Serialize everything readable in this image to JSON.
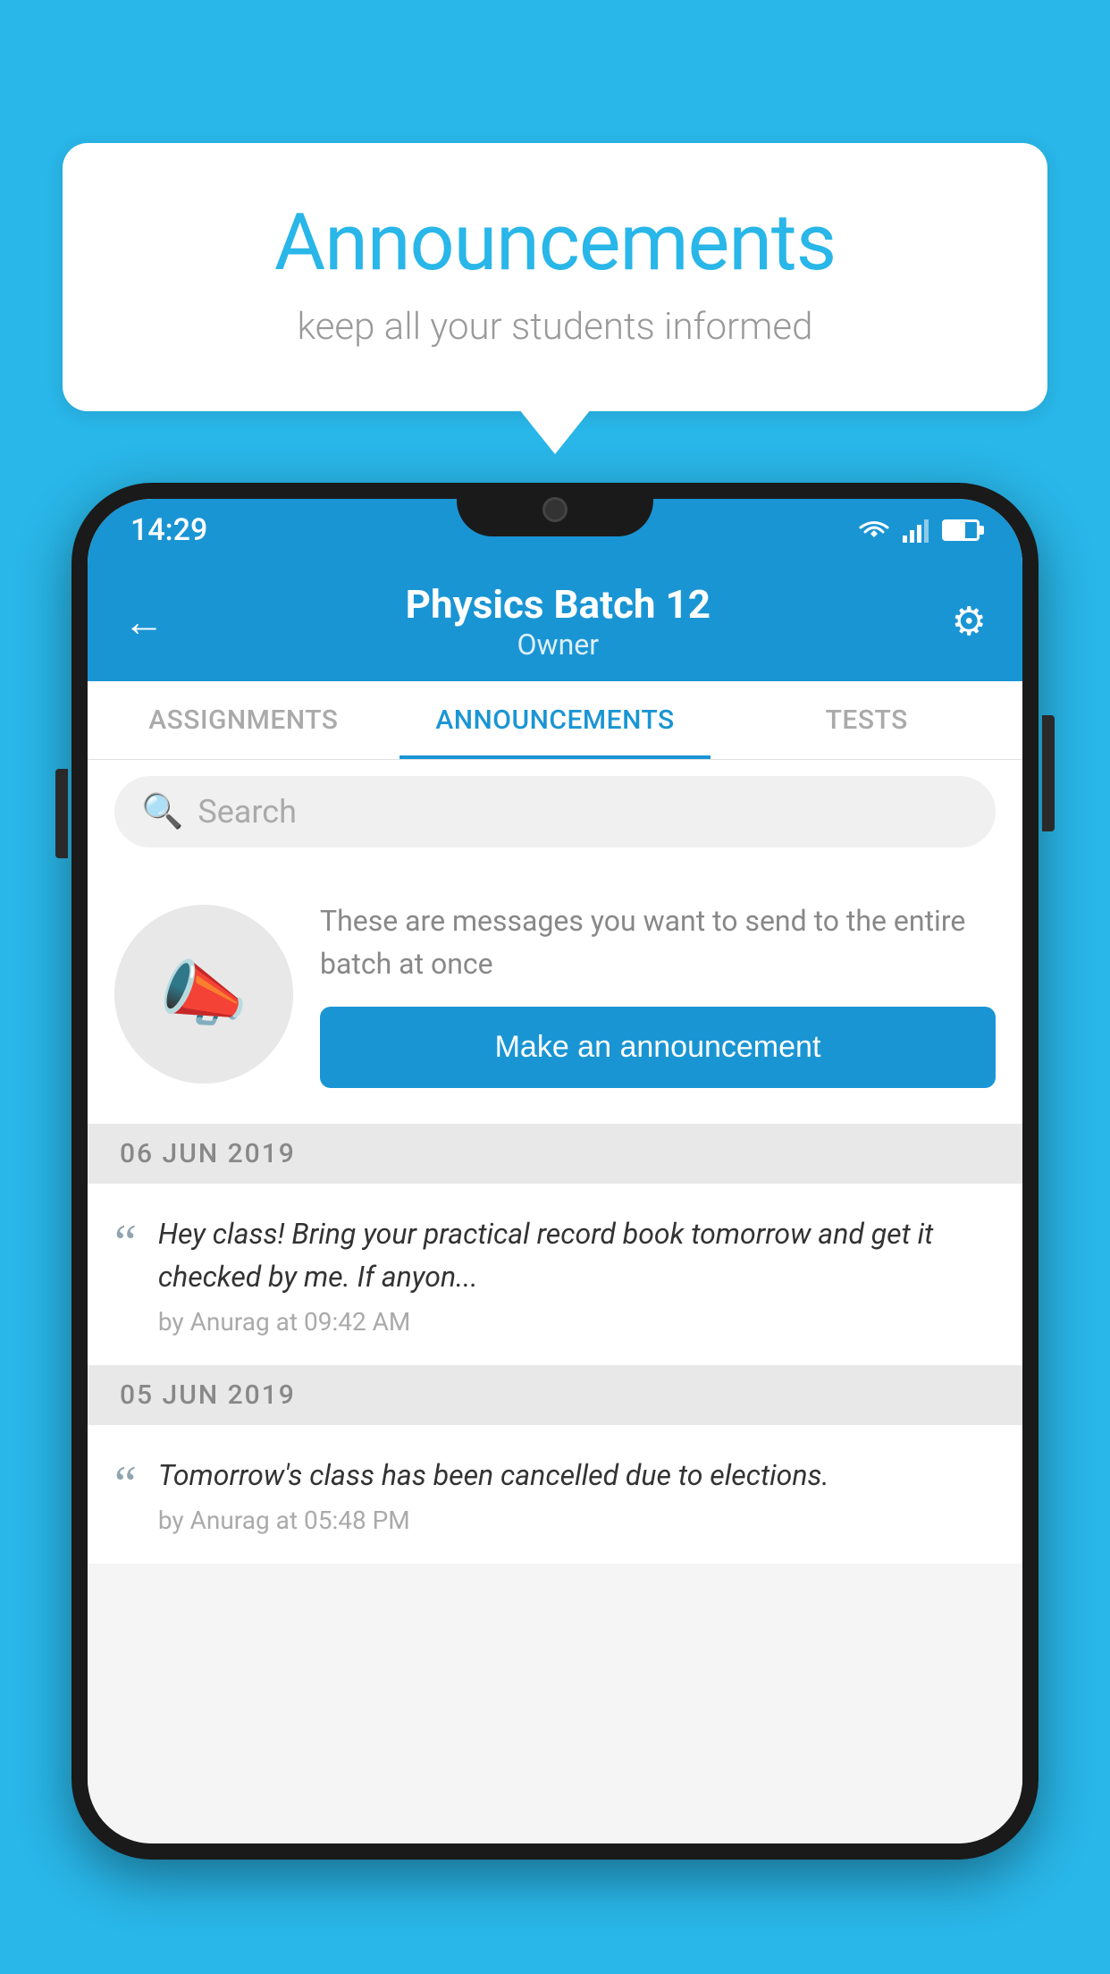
{
  "bubble": {
    "title": "Announcements",
    "subtitle": "keep all your students informed"
  },
  "status_bar": {
    "time": "14:29",
    "wifi": "▼",
    "signal": "▲",
    "battery": ""
  },
  "header": {
    "back_label": "←",
    "title": "Physics Batch 12",
    "subtitle": "Owner",
    "gear_label": "⚙"
  },
  "tabs": [
    {
      "label": "ASSIGNMENTS",
      "active": false
    },
    {
      "label": "ANNOUNCEMENTS",
      "active": true
    },
    {
      "label": "TESTS",
      "active": false
    }
  ],
  "search": {
    "placeholder": "Search"
  },
  "promo": {
    "description": "These are messages you want to send to the entire batch at once",
    "button_label": "Make an announcement"
  },
  "announcements": [
    {
      "date": "06  JUN  2019",
      "text": "Hey class! Bring your practical record book tomorrow and get it checked by me. If anyon...",
      "meta": "by Anurag at 09:42 AM"
    },
    {
      "date": "05  JUN  2019",
      "text": "Tomorrow's class has been cancelled due to elections.",
      "meta": "by Anurag at 05:48 PM"
    }
  ],
  "colors": {
    "primary": "#29b6e8",
    "app_blue": "#1a95d4",
    "text_dark": "#333",
    "text_gray": "#888",
    "text_light": "#aaa"
  }
}
